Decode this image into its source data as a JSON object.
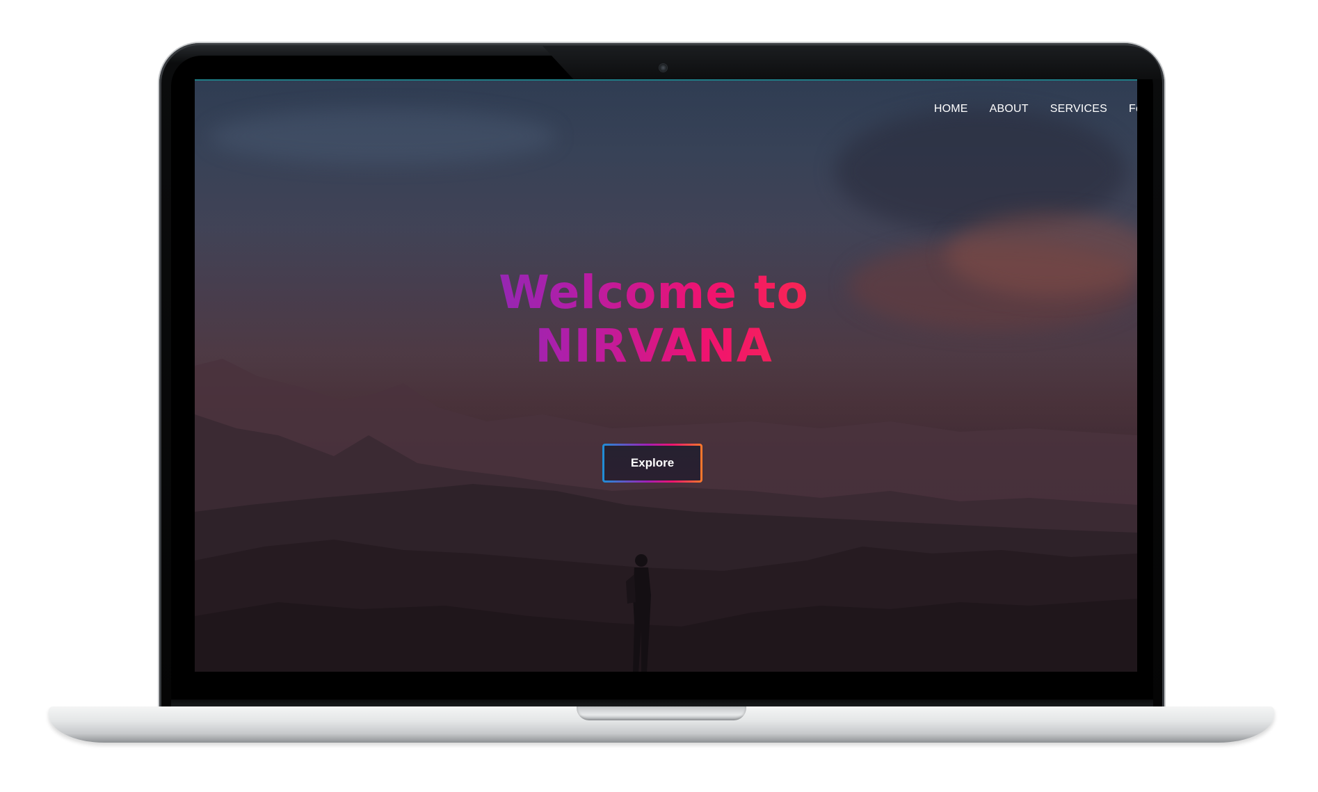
{
  "nav": {
    "items": [
      {
        "label": "HOME"
      },
      {
        "label": "ABOUT"
      },
      {
        "label": "SERVICES"
      },
      {
        "label": "Fo"
      }
    ]
  },
  "hero": {
    "title": "Welcome to NIRVANA",
    "button_label": "Explore"
  },
  "colors": {
    "title_gradient_start": "#6a35c2",
    "title_gradient_mid": "#f0136f",
    "title_gradient_end": "#ff3b34",
    "button_border_start": "#1e8fd6",
    "button_border_end": "#ff7a2a",
    "nav_text": "#ffffff"
  },
  "icons": {
    "camera": "webcam-icon"
  }
}
